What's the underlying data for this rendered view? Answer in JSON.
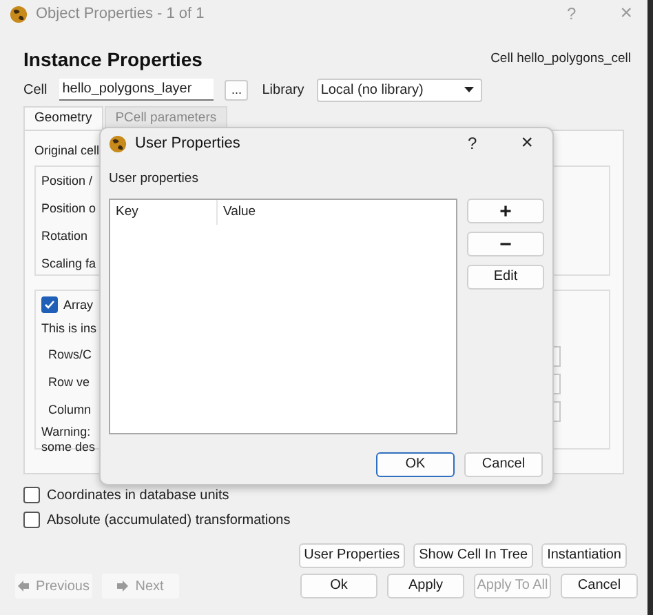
{
  "main_window": {
    "title": "Object Properties - 1 of 1",
    "help": "?",
    "close": "×"
  },
  "header": {
    "title": "Instance Properties",
    "cell_caption": "Cell hello_polygons_cell"
  },
  "cell_row": {
    "label": "Cell",
    "value": "hello_polygons_layer",
    "browse": "...",
    "library_label": "Library",
    "library_value": "Local (no library)"
  },
  "tabs": [
    {
      "label": "Geometry",
      "selected": true
    },
    {
      "label": "PCell parameters",
      "selected": false
    }
  ],
  "geometry": {
    "original_cell": "Original cell",
    "position_group": {
      "title": "Position /",
      "rows": [
        "Position o",
        "Rotation",
        "Scaling fa"
      ]
    },
    "array_group": {
      "label": "Array",
      "checked": true,
      "note": "This is ins",
      "rows": [
        "Rows/C",
        "Row ve",
        "Column"
      ],
      "warning": [
        "Warning:",
        "some des"
      ]
    }
  },
  "options": [
    {
      "label": "Coordinates in database units",
      "checked": false
    },
    {
      "label": "Absolute (accumulated) transformations",
      "checked": false
    }
  ],
  "action_buttons": [
    "User Properties",
    "Show Cell In Tree",
    "Instantiation"
  ],
  "nav_buttons": [
    {
      "label": "Previous",
      "kind": "back",
      "disabled": true
    },
    {
      "label": "Next",
      "kind": "forward",
      "disabled": true
    }
  ],
  "footer_buttons": [
    {
      "label": "Ok",
      "disabled": false
    },
    {
      "label": "Apply",
      "disabled": false
    },
    {
      "label": "Apply To All",
      "disabled": true
    },
    {
      "label": "Cancel",
      "disabled": false
    }
  ],
  "dialog": {
    "title": "User Properties",
    "help": "?",
    "close": "×",
    "caption": "User properties",
    "columns": [
      "Key",
      "Value"
    ],
    "side_buttons": [
      {
        "label": "+",
        "kind": "symbol"
      },
      {
        "label": "−",
        "kind": "symbol"
      },
      {
        "label": "Edit",
        "kind": "text"
      }
    ],
    "buttons": [
      {
        "label": "OK",
        "default": true
      },
      {
        "label": "Cancel",
        "default": false
      }
    ]
  }
}
